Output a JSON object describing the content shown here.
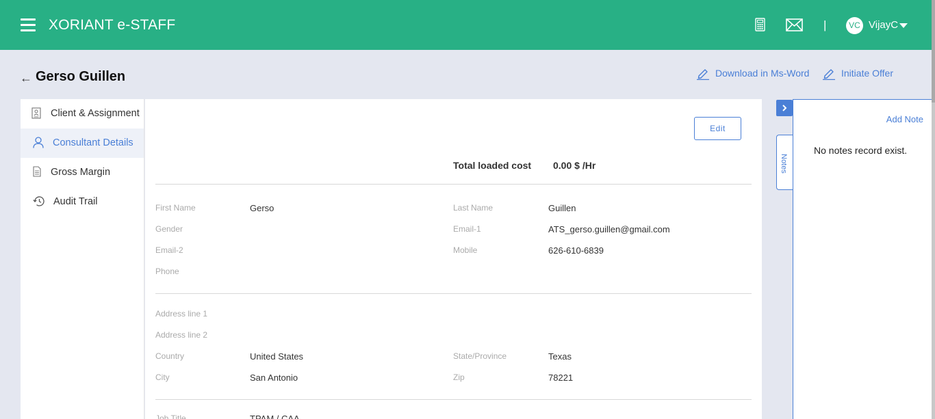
{
  "app": {
    "title": "XORIANT e-STAFF"
  },
  "topbar": {
    "separator": "|",
    "user_initials": "VC",
    "user_name": "VijayC",
    "icons": [
      "menu-icon",
      "calculator-icon",
      "mail-icon",
      "caret-down-icon"
    ]
  },
  "header": {
    "back": "←",
    "title": "Gerso Guillen",
    "actions": [
      {
        "label": "Download in Ms-Word",
        "icon": "pencil-icon"
      },
      {
        "label": "Initiate Offer",
        "icon": "pencil-icon"
      }
    ]
  },
  "sidebar": {
    "items": [
      {
        "label": "Client & Assignment",
        "icon": "document-icon",
        "active": false
      },
      {
        "label": "Consultant Details",
        "icon": "user-icon",
        "active": true
      },
      {
        "label": "Gross Margin",
        "icon": "file-icon",
        "active": false
      },
      {
        "label": "Audit Trail",
        "icon": "history-icon",
        "active": false
      }
    ]
  },
  "main": {
    "edit_label": "Edit",
    "total_loaded_cost": {
      "label": "Total loaded cost",
      "value": "0.00 $ /Hr"
    },
    "personal": {
      "first_name": {
        "label": "First Name",
        "value": "Gerso"
      },
      "last_name": {
        "label": "Last Name",
        "value": "Guillen"
      },
      "gender": {
        "label": "Gender",
        "value": ""
      },
      "email1": {
        "label": "Email-1",
        "value": "ATS_gerso.guillen@gmail.com"
      },
      "email2": {
        "label": "Email-2",
        "value": ""
      },
      "mobile": {
        "label": "Mobile",
        "value": "626-610-6839"
      },
      "phone": {
        "label": "Phone",
        "value": ""
      }
    },
    "address": {
      "line1": {
        "label": "Address line 1",
        "value": ""
      },
      "line2": {
        "label": "Address line 2",
        "value": ""
      },
      "country": {
        "label": "Country",
        "value": "United States"
      },
      "state": {
        "label": "State/Province",
        "value": "Texas"
      },
      "city": {
        "label": "City",
        "value": "San Antonio"
      },
      "zip": {
        "label": "Zip",
        "value": "78221"
      }
    },
    "job": {
      "title": {
        "label": "Job Title",
        "value": "TPAM / CAA"
      }
    }
  },
  "notes": {
    "tab_label": "Notes",
    "add_label": "Add Note",
    "empty_text": "No notes record exist."
  },
  "colors": {
    "brand": "#28b085",
    "accent": "#4a7fd6",
    "background": "#e4e7f0"
  }
}
